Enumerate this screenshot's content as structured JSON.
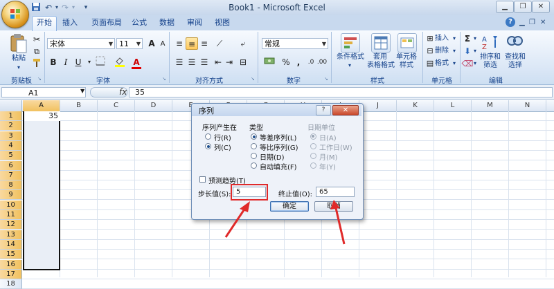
{
  "window": {
    "title": "Book1 - Microsoft Excel",
    "qat_icons": [
      "save-icon",
      "undo-icon",
      "redo-icon",
      "customize-qat-icon"
    ],
    "controls": [
      "minimize",
      "restore",
      "close"
    ]
  },
  "tabs": [
    {
      "label": "开始",
      "active": true
    },
    {
      "label": "插入"
    },
    {
      "label": "页面布局"
    },
    {
      "label": "公式"
    },
    {
      "label": "数据"
    },
    {
      "label": "审阅"
    },
    {
      "label": "视图"
    }
  ],
  "ribbon": {
    "clipboard": {
      "paste_label": "粘贴",
      "group": "剪贴板"
    },
    "font": {
      "name": "宋体",
      "size": "11",
      "group": "字体",
      "bold": "B",
      "italic": "I",
      "underline": "U",
      "grow": "A",
      "shrink": "A"
    },
    "alignment": {
      "group": "对齐方式"
    },
    "number": {
      "format": "常规",
      "group": "数字",
      "percent": "%",
      "comma": ","
    },
    "styles": {
      "group": "样式",
      "conditional": [
        "条件格式"
      ],
      "table": [
        "套用",
        "表格格式"
      ],
      "cell": [
        "单元格",
        "样式"
      ]
    },
    "cells": {
      "group": "单元格",
      "insert": "插入",
      "delete": "删除",
      "format": "格式"
    },
    "editing": {
      "group": "编辑",
      "sum": "Σ",
      "sort": [
        "排序和",
        "筛选"
      ],
      "find": [
        "查找和",
        "选择"
      ]
    }
  },
  "formula_bar": {
    "cell_ref": "A1",
    "fx": "fx",
    "value": "35"
  },
  "sheet": {
    "columns": [
      "A",
      "B",
      "C",
      "D",
      "E",
      "F",
      "G",
      "H",
      "I",
      "J",
      "K",
      "L",
      "M",
      "N"
    ],
    "rows": [
      "1",
      "2",
      "3",
      "4",
      "5",
      "6",
      "7",
      "8",
      "9",
      "10",
      "11",
      "12",
      "13",
      "14",
      "15",
      "16",
      "17",
      "18"
    ],
    "cell_a1": "35",
    "selected_column": "A"
  },
  "dialog": {
    "title": "序列",
    "series_in": {
      "label": "序列产生在",
      "options": [
        "行(R)",
        "列(C)"
      ],
      "selected": "列(C)"
    },
    "type": {
      "label": "类型",
      "options": [
        "等差序列(L)",
        "等比序列(G)",
        "日期(D)",
        "自动填充(F)"
      ],
      "selected": "等差序列(L)"
    },
    "date_unit": {
      "label": "日期单位",
      "options": [
        "日(A)",
        "工作日(W)",
        "月(M)",
        "年(Y)"
      ],
      "selected": "日(A)",
      "disabled": true
    },
    "trend_label": "预测趋势(T)",
    "step_label": "步长值(S):",
    "step_value": "5",
    "stop_label": "终止值(O):",
    "stop_value": "65",
    "ok_label": "确定",
    "cancel_label": "取消"
  },
  "colors": {
    "annotation": "#e02a2a",
    "title_bar": "#c7d7ec",
    "selection": "#f1c15f"
  }
}
